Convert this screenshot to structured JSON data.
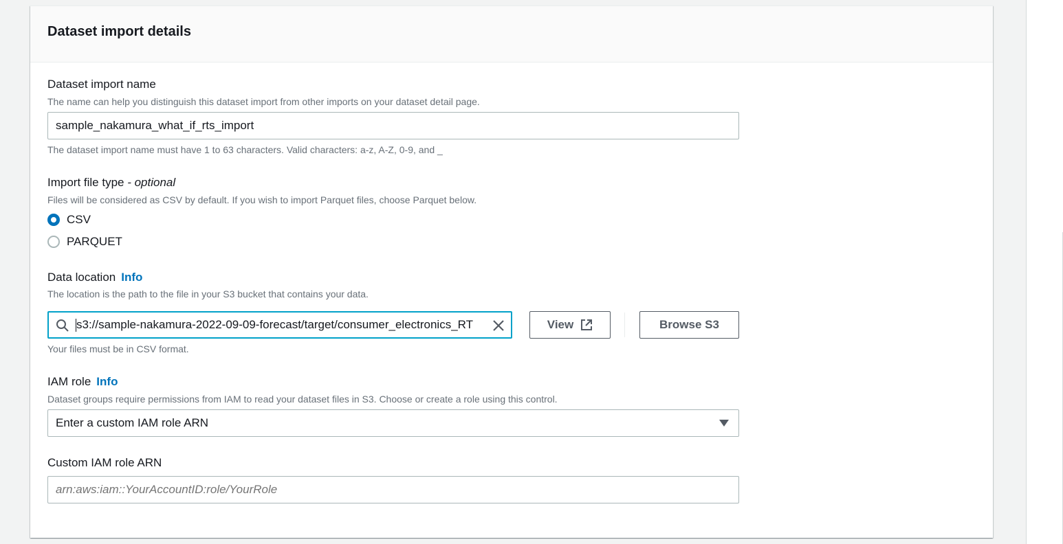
{
  "container": {
    "title": "Dataset import details"
  },
  "import_name": {
    "label": "Dataset import name",
    "description": "The name can help you distinguish this dataset import from other imports on your dataset detail page.",
    "value": "sample_nakamura_what_if_rts_import",
    "constraint": "The dataset import name must have 1 to 63 characters. Valid characters: a-z, A-Z, 0-9, and _"
  },
  "file_type": {
    "label": "Import file type",
    "optional": " - optional",
    "description": "Files will be considered as CSV by default. If you wish to import Parquet files, choose Parquet below.",
    "options": [
      {
        "label": "CSV",
        "selected": true
      },
      {
        "label": "PARQUET",
        "selected": false
      }
    ]
  },
  "data_location": {
    "label": "Data location",
    "info": "Info",
    "description": "The location is the path to the file in your S3 bucket that contains your data.",
    "value": "s3://sample-nakamura-2022-09-09-forecast/target/consumer_electronics_RT",
    "view_button": "View",
    "browse_button": "Browse S3",
    "hint": "Your files must be in CSV format."
  },
  "iam_role": {
    "label": "IAM role",
    "info": "Info",
    "description": "Dataset groups require permissions from IAM to read your dataset files in S3. Choose or create a role using this control.",
    "selected": "Enter a custom IAM role ARN"
  },
  "custom_arn": {
    "label": "Custom IAM role ARN",
    "placeholder": "arn:aws:iam::YourAccountID:role/YourRole",
    "value": ""
  },
  "colors": {
    "accent": "#0073bb",
    "focus": "#00a1c9",
    "text": "#16191f",
    "secondary_text": "#687078"
  }
}
